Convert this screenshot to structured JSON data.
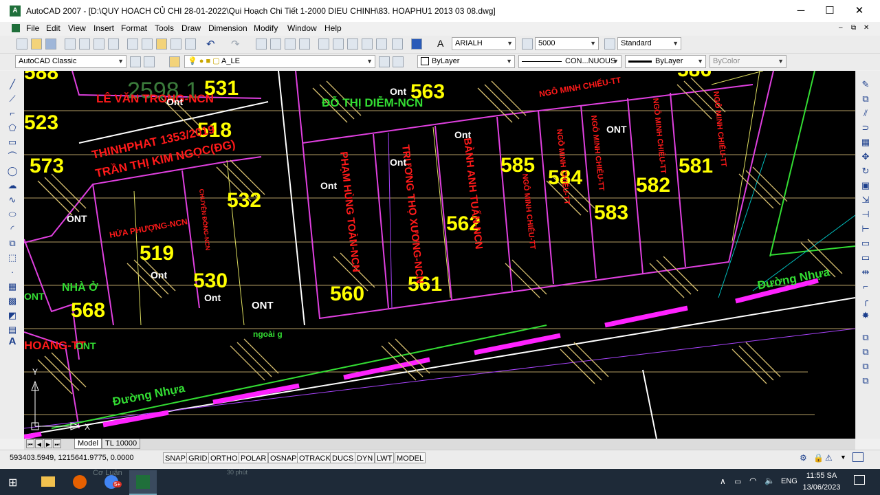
{
  "window": {
    "title": "AutoCAD 2007 - [D:\\QUY HOACH CỦ CHI 28-01-2022\\Qui Hoạch Chi Tiết 1-2000 DIEU CHINH\\83. HOAPHU1 2013 03 08.dwg]",
    "app_icon_text": "A",
    "minimize_label": "─",
    "maximize_label": "☐",
    "close_label": "✕"
  },
  "menu": {
    "items": [
      "File",
      "Edit",
      "View",
      "Insert",
      "Format",
      "Tools",
      "Draw",
      "Dimension",
      "Modify",
      "Window",
      "Help"
    ],
    "doc_controls": [
      "–",
      "⧉",
      "✕"
    ]
  },
  "toolbar": {
    "text_style_font": "ARIALH",
    "dim_scale": "5000",
    "table_style": "Standard",
    "workspace": "AutoCAD Classic",
    "layer": "A_LE",
    "color": "ByLayer",
    "linetype": "CON...NUOUS",
    "lineweight": "ByLayer",
    "plotstyle": "ByColor"
  },
  "drawing": {
    "lot_numbers": [
      "531",
      "518",
      "523",
      "573",
      "519",
      "530",
      "568",
      "532",
      "563",
      "562",
      "561",
      "560",
      "585",
      "584",
      "583",
      "582",
      "581"
    ],
    "owner_labels": {
      "le_van_trong": "LÊ VĂN TRONG-NCN",
      "thinh_phat": "THINHPHAT 1353/2019",
      "tran_thi_kim": "TRẦN THỊ KIM NGỌC(ĐG)",
      "hua_phuong": "HỨA PHƯỢNG-NCN",
      "do_thi_diem": "ĐỖ THỊ DIỄM-NCN",
      "ngo_minh_chieu": "NGÔ MINH CHIẾU-TT",
      "pham_hung_toan": "PHẠM HÙNG TOÀN-NCN",
      "truong_tho_xuong": "TRƯƠNG THỌ XƯƠNG-NCN",
      "banh_anh_tuan": "BÀNH ANH TUẤN-NCN",
      "ngo_minh_chieu_v1": "NGÔ MINH CHIẾU-TT",
      "ngo_minh_chieu_v2": "NGÔ MINH CHIẾU-TT",
      "ngo_minh_chieu_v3": "NGÔ MINH CHIẾU-TT",
      "ngo_minh_chieu_v4": "NGÔ MINH CHIẾU-TT",
      "ngo_minh_chieu_v5": "NGÔ MINH CHIẾU-TT",
      "chuyen_dung": "CHUYÊN ĐỒNG-NCN",
      "hoang_tt": "HOÀNG-TT"
    },
    "land_use": {
      "ont_1": "Ont",
      "ont_2": "Ont",
      "ont_3": "Ont",
      "ont_4": "Ont",
      "ont_5": "Ont",
      "ont_6": "Ont",
      "ont_7": "Ont",
      "ont_8": "Ont",
      "ONT_1": "ONT",
      "ONT_2": "ONT",
      "ONT_3": "ONT",
      "ONT_4": "ONT",
      "ONT_5": "ONT",
      "nha_o": "NHÀ Ở",
      "ngoai_g": "ngoài g"
    },
    "roads": {
      "road_1": "Đường Nhựa",
      "road_2": "Đường Nhựa"
    },
    "top_partial_numbers": {
      "left": "588",
      "right": "586"
    },
    "faint_watermark": "2598 1"
  },
  "layout_tabs": {
    "model": "Model",
    "layout1": "TL 10000"
  },
  "status": {
    "coordinates": "593403.5949, 1215641.9775, 0.0000",
    "toggles": [
      "SNAP",
      "GRID",
      "ORTHO",
      "POLAR",
      "OSNAP",
      "OTRACK",
      "DUCS",
      "DYN",
      "LWT",
      "MODEL"
    ]
  },
  "taskbar": {
    "partial_text": "Cơ Luận",
    "partial_text2": "30 phút",
    "language": "ENG",
    "time": "11:55 SA",
    "date": "13/06/2023",
    "badge": "5+"
  },
  "colors": {
    "canvas": "#000000",
    "lot_number": "#ffff00",
    "owner_text": "#ff1a1a",
    "green_text": "#33dd33",
    "boundary": "#e040e0",
    "hatch": "#d8c070",
    "road_highlight": "#ff22ff"
  }
}
